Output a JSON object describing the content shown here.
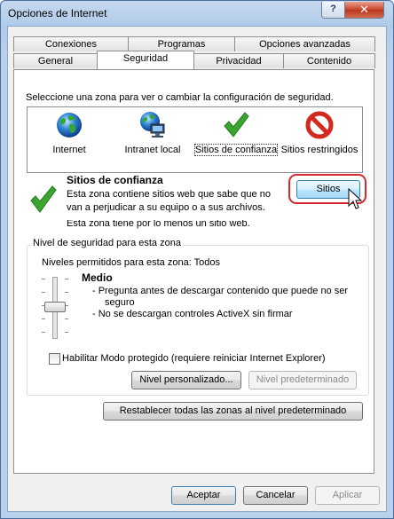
{
  "window": {
    "title": "Opciones de Internet",
    "help_label": "?",
    "close_label": "✕"
  },
  "tabs_top": [
    "Conexiones",
    "Programas",
    "Opciones avanzadas"
  ],
  "tabs_bottom": [
    "General",
    "Seguridad",
    "Privacidad",
    "Contenido"
  ],
  "instruction": "Seleccione una zona para ver o cambiar la configuración de seguridad.",
  "zones": [
    {
      "label": "Internet",
      "icon": "globe-icon"
    },
    {
      "label": "Intranet local",
      "icon": "intranet-icon"
    },
    {
      "label": "Sitios de confianza",
      "icon": "checkmark-icon"
    },
    {
      "label": "Sitios restringidos",
      "icon": "restricted-icon"
    }
  ],
  "zone_info": {
    "title": "Sitios de confianza",
    "line1": "Esta zona contiene sitios web que sabe que no",
    "line2": "van a perjudicar a su equipo o a sus archivos.",
    "line3": "Esta zona tiene por lo menos un sitio web."
  },
  "sites_button": "Sitios",
  "security_group": {
    "title": "Nivel de seguridad para esta zona",
    "allowed": "Niveles permitidos para esta zona: Todos",
    "level": "Medio",
    "bullet1a": "- Pregunta antes de descargar contenido que puede no ser",
    "bullet1b": "seguro",
    "bullet2": "- No se descargan controles ActiveX sin firmar",
    "protected_mode": "Habilitar Modo protegido (requiere reiniciar Internet Explorer)",
    "custom_level": "Nivel personalizado...",
    "default_level": "Nivel predeterminado"
  },
  "reset_all": "Restablecer todas las zonas al nivel predeterminado",
  "footer": {
    "ok": "Aceptar",
    "cancel": "Cancelar",
    "apply": "Aplicar"
  },
  "colors": {
    "highlight_ring": "#d9272e",
    "check_green": "#3aa52f",
    "restricted_red": "#d22a1f"
  }
}
